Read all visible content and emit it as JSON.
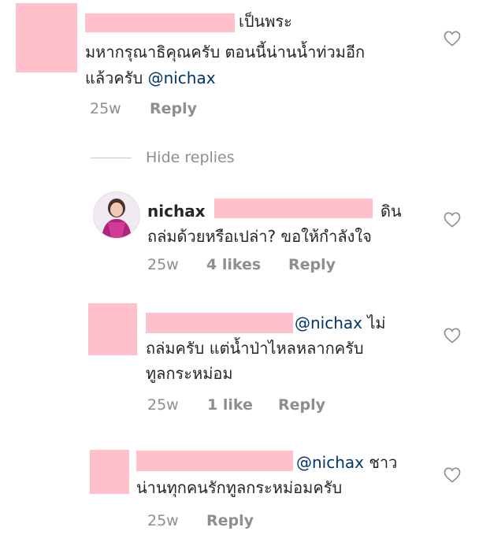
{
  "comments": [
    {
      "lines": [
        "เป็นพระ",
        "มหากรุณาธิคุณครับ ตอนนี้น่านน้ำท่วมอีก",
        "แล้วครับ"
      ],
      "mention": "@nichax",
      "time": "25w",
      "reply_label": "Reply"
    }
  ],
  "hide_replies_label": "Hide replies",
  "replies": [
    {
      "username": "nichax",
      "lines": [
        "ดิน",
        "ถล่มด้วยหรือเปล่า? ขอให้กำลังใจ"
      ],
      "time": "25w",
      "likes": "4 likes",
      "reply_label": "Reply"
    },
    {
      "mention": "@nichax",
      "lines": [
        "ไม่",
        "ถล่มครับ แต่น้ำป่าไหลหลากครับ",
        "ทูลกระหม่อม"
      ],
      "time": "25w",
      "likes": "1 like",
      "reply_label": "Reply"
    },
    {
      "mention": "@nichax",
      "lines": [
        "ชาว",
        "น่านทุกคนรักทูลกระหม่อมครับ"
      ],
      "time": "25w",
      "reply_label": "Reply"
    }
  ],
  "icons": {
    "heart": "heart-outline-icon",
    "avatar": "profile-avatar"
  },
  "colors": {
    "redaction": "#ffc0cb",
    "mention": "#003569",
    "meta": "#8e8e8e"
  }
}
